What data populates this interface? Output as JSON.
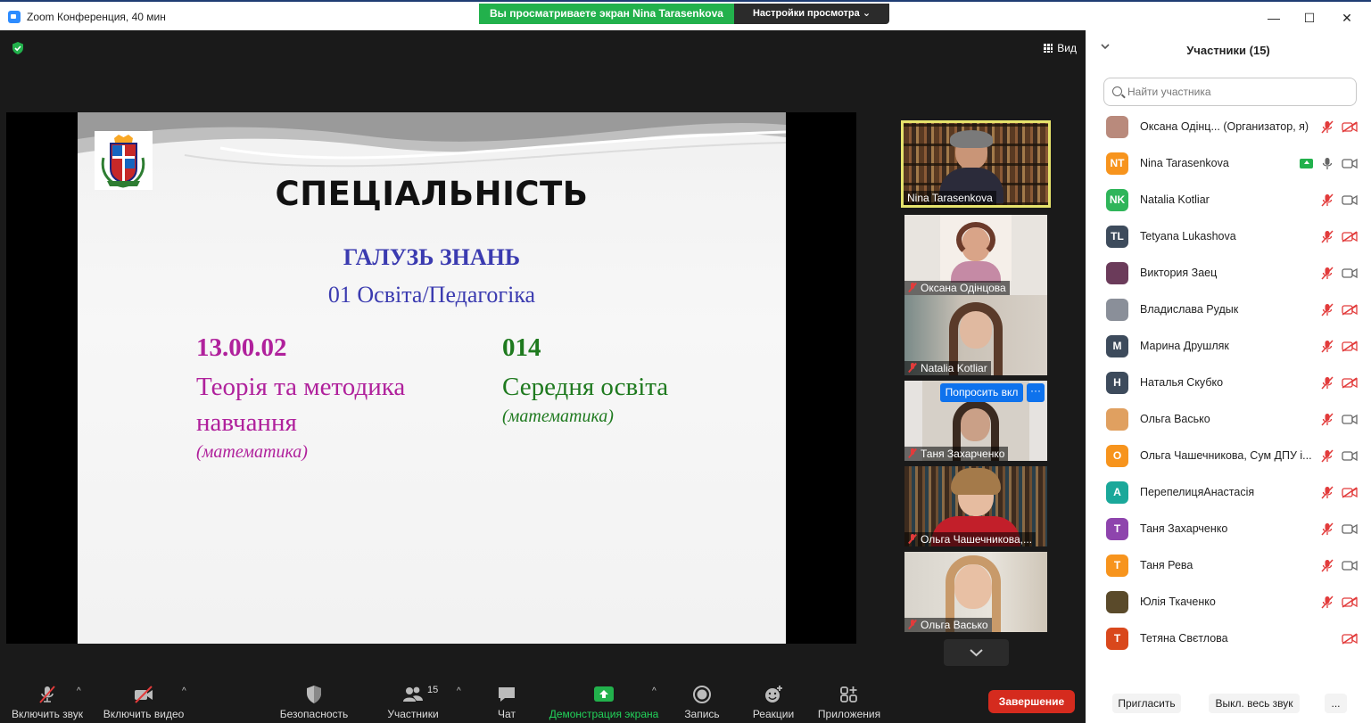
{
  "window": {
    "title": "Zoom Конференция, 40 мин",
    "share_banner": "Вы просматриваете экран Nina Tarasenkova",
    "view_options": "Настройки просмотра",
    "minimize": "—",
    "maximize": "☐",
    "close": "✕"
  },
  "meeting": {
    "view_label": "Вид"
  },
  "slide": {
    "title": "СПЕЦІАЛЬНІСТЬ",
    "field_label": "ГАЛУЗЬ ЗНАНЬ",
    "field_value": "01 Освіта/Педагогіка",
    "left": {
      "code": "13.00.02",
      "name_line1": "Теорія та методика",
      "name_line2": "навчання",
      "sub": "(математика)"
    },
    "right": {
      "code": "014",
      "name": "Середня освіта",
      "sub": "(математика)"
    }
  },
  "video_tiles": [
    {
      "name": "Nina Tarasenkova",
      "muted": false,
      "active": true
    },
    {
      "name": "Оксана Одінцова",
      "muted": true
    },
    {
      "name": "Natalia Kotliar",
      "muted": true
    },
    {
      "name": "Таня Захарченко",
      "muted": true
    },
    {
      "name": "Ольга Чашечникова,...",
      "muted": true
    },
    {
      "name": "Ольга Васько",
      "muted": true
    }
  ],
  "tile_menu": {
    "ask_label": "Попросить вкл",
    "more_label": "···"
  },
  "toolbar": {
    "audio": "Включить звук",
    "video": "Включить видео",
    "security": "Безопасность",
    "participants": "Участники",
    "participants_count": "15",
    "chat": "Чат",
    "share": "Демонстрация экрана",
    "record": "Запись",
    "reactions": "Реакции",
    "apps": "Приложения",
    "end": "Завершение"
  },
  "participants_panel": {
    "title": "Участники (15)",
    "search_placeholder": "Найти участника",
    "invite": "Пригласить",
    "mute_all": "Выкл. весь звук",
    "more": "...",
    "list": [
      {
        "name": "Оксана Одінц...  (Организатор, я)",
        "initials": "",
        "color": "#b98a7c",
        "mic": "off",
        "cam": "off"
      },
      {
        "name": "Nina Tarasenkova",
        "initials": "NT",
        "color": "#f7941d",
        "mic": "on",
        "cam": "on",
        "sharing": true
      },
      {
        "name": "Natalia Kotliar",
        "initials": "NK",
        "color": "#2fb55a",
        "mic": "off",
        "cam": "on"
      },
      {
        "name": "Tetyana Lukashova",
        "initials": "TL",
        "color": "#3d4b5c",
        "mic": "off",
        "cam": "off"
      },
      {
        "name": "Виктория Заец",
        "initials": "",
        "color": "#6b3b5a",
        "mic": "off",
        "cam": "on"
      },
      {
        "name": "Владислава Рудык",
        "initials": "",
        "color": "#8a8f99",
        "mic": "off",
        "cam": "off"
      },
      {
        "name": "Марина Друшляк",
        "initials": "M",
        "color": "#3d4b5c",
        "mic": "off",
        "cam": "off"
      },
      {
        "name": "Наталья Скубко",
        "initials": "Н",
        "color": "#3d4b5c",
        "mic": "off",
        "cam": "off"
      },
      {
        "name": "Ольга Васько",
        "initials": "",
        "color": "#e0a060",
        "mic": "off",
        "cam": "on"
      },
      {
        "name": "Ольга Чашечникова, Сум ДПУ і...",
        "initials": "O",
        "color": "#f7941d",
        "mic": "off",
        "cam": "on"
      },
      {
        "name": "ПерепелицяАнастасія",
        "initials": "A",
        "color": "#1aa89a",
        "mic": "off",
        "cam": "off"
      },
      {
        "name": "Таня Захарченко",
        "initials": "T",
        "color": "#8e44ad",
        "mic": "off",
        "cam": "on"
      },
      {
        "name": "Таня Рева",
        "initials": "T",
        "color": "#f7941d",
        "mic": "off",
        "cam": "on"
      },
      {
        "name": "Юлія Ткаченко",
        "initials": "",
        "color": "#5a4a2a",
        "mic": "off",
        "cam": "off"
      },
      {
        "name": "Тетяна Свєтлова",
        "initials": "T",
        "color": "#d9481c",
        "mic": "none",
        "cam": "off"
      }
    ]
  }
}
